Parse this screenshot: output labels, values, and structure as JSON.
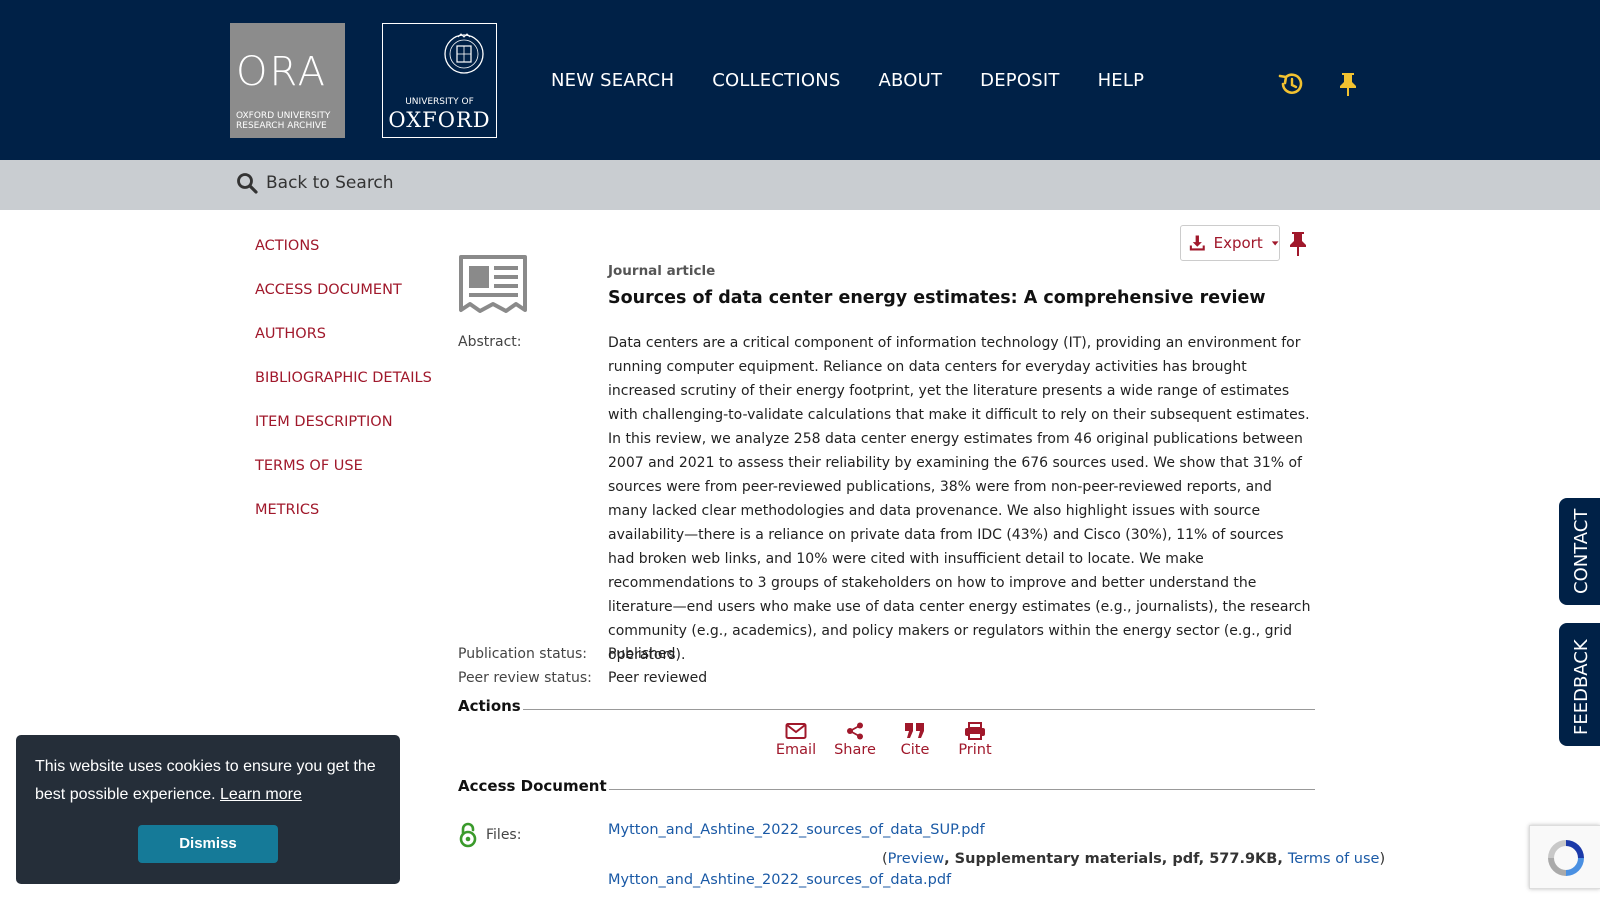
{
  "header": {
    "logo_ora": {
      "big": "ORA",
      "line1": "OXFORD UNIVERSITY",
      "line2": "RESEARCH ARCHIVE"
    },
    "logo_oxford": {
      "line1": "UNIVERSITY OF",
      "line2": "OXFORD"
    },
    "nav": [
      "NEW SEARCH",
      "COLLECTIONS",
      "ABOUT",
      "DEPOSIT",
      "HELP"
    ],
    "icons": [
      "history-icon",
      "pin-icon"
    ],
    "accent": "#f2c230",
    "bg": "#002147"
  },
  "backbar": {
    "label": "Back to Search"
  },
  "leftmenu": [
    "ACTIONS",
    "ACCESS DOCUMENT",
    "AUTHORS",
    "BIBLIOGRAPHIC DETAILS",
    "ITEM DESCRIPTION",
    "TERMS OF USE",
    "METRICS"
  ],
  "record": {
    "export_label": "Export",
    "type": "Journal article",
    "title": "Sources of data center energy estimates: A comprehensive review",
    "abstract_label": "Abstract:",
    "abstract": "Data centers are a critical component of information technology (IT), providing an environment for running computer equipment. Reliance on data centers for everyday activities has brought increased scrutiny of their energy footprint, yet the literature presents a wide range of estimates with challenging-to-validate calculations that make it difficult to rely on their subsequent estimates. In this review, we analyze 258 data center energy estimates from 46 original publications between 2007 and 2021 to assess their reliability by examining the 676 sources used. We show that 31% of sources were from peer-reviewed publications, 38% were from non-peer-reviewed reports, and many lacked clear methodologies and data provenance. We also highlight issues with source availability—there is a reliance on private data from IDC (43%) and Cisco (30%), 11% of sources had broken web links, and 10% were cited with insufficient detail to locate. We make recommendations to 3 groups of stakeholders on how to improve and better understand the literature—end users who make use of data center energy estimates (e.g., journalists), the research community (e.g., academics), and policy makers or regulators within the energy sector (e.g., grid operators).",
    "pub_status_label": "Publication status:",
    "pub_status": "Published",
    "peer_label": "Peer review status:",
    "peer": "Peer reviewed"
  },
  "actions": {
    "title": "Actions",
    "items": [
      "Email",
      "Share",
      "Cite",
      "Print"
    ]
  },
  "access": {
    "title": "Access Document",
    "files_label": "Files:",
    "file1": "Mytton_and_Ashtine_2022_sources_of_data_SUP.pdf",
    "file1_meta": {
      "open": "(",
      "preview": "Preview",
      "details": ", Supplementary materials, pdf, 577.9KB, ",
      "terms": "Terms of use",
      "close": ")"
    },
    "file2": "Mytton_and_Ashtine_2022_sources_of_data.pdf"
  },
  "sidetabs": [
    "CONTACT",
    "FEEDBACK"
  ],
  "cookie": {
    "message": "This website uses cookies to ensure you get the best possible experience.",
    "learn_more": "Learn more",
    "dismiss": "Dismiss"
  },
  "colors": {
    "link_red": "#a0182b",
    "link_blue": "#1b5aa6",
    "open_access_green": "#3a9a2b"
  }
}
